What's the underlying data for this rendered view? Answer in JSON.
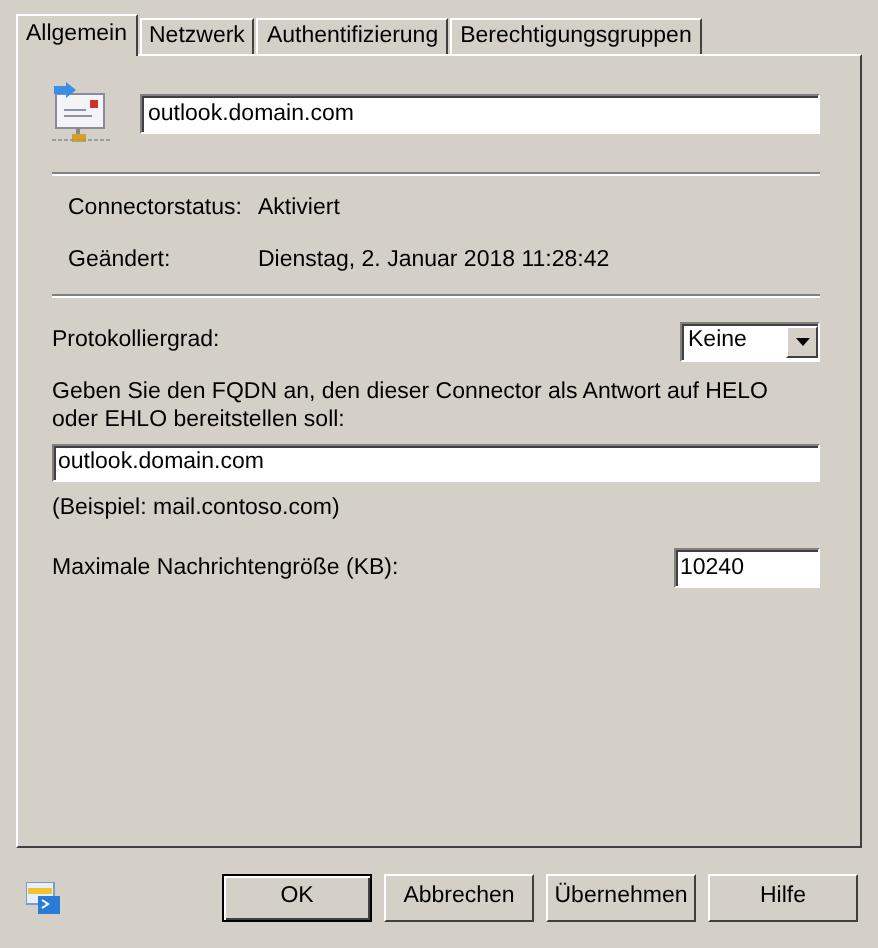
{
  "tabs": [
    {
      "label": "Allgemein",
      "selected": true
    },
    {
      "label": "Netzwerk",
      "selected": false
    },
    {
      "label": "Authentifizierung",
      "selected": false
    },
    {
      "label": "Berechtigungsgruppen",
      "selected": false
    }
  ],
  "name_field": {
    "value": "outlook.domain.com"
  },
  "info": [
    {
      "label": "Connectorstatus:",
      "value": "Aktiviert"
    },
    {
      "label": "Geändert:",
      "value": "Dienstag, 2. Januar 2018 11:28:42"
    }
  ],
  "logging": {
    "label": "Protokolliergrad:",
    "value": "Keine"
  },
  "fqdn": {
    "label": "Geben Sie den FQDN an, den dieser Connector als Antwort auf HELO oder EHLO bereitstellen soll:",
    "value": "outlook.domain.com",
    "hint": "(Beispiel: mail.contoso.com)"
  },
  "max_size": {
    "label": "Maximale Nachrichtengröße (KB):",
    "value": "10240"
  },
  "buttons": [
    {
      "label": "OK",
      "default": true
    },
    {
      "label": "Abbrechen",
      "default": false
    },
    {
      "label": "Übernehmen",
      "default": false
    },
    {
      "label": "Hilfe",
      "default": false
    }
  ]
}
